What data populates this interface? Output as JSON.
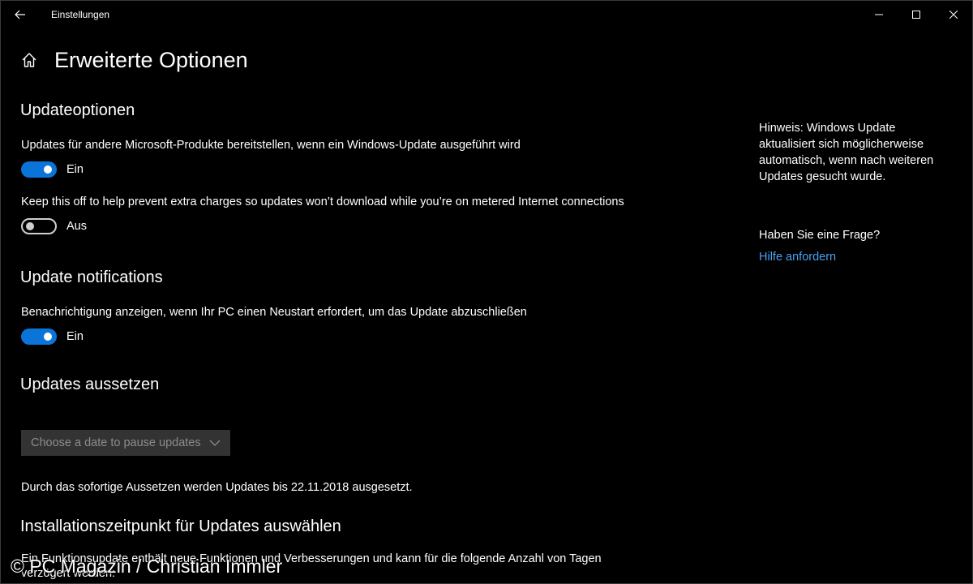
{
  "window": {
    "app_title": "Einstellungen"
  },
  "page": {
    "title": "Erweiterte Optionen"
  },
  "update_options": {
    "heading": "Updateoptionen",
    "other_products": {
      "text": "Updates für andere Microsoft-Produkte bereitstellen, wenn ein Windows-Update ausgeführt wird",
      "state": "Ein"
    },
    "metered": {
      "text": "Keep this off to help prevent extra charges so updates won’t download while you’re on metered Internet connections",
      "state": "Aus"
    }
  },
  "notifications": {
    "heading": "Update notifications",
    "restart_notice": {
      "text": "Benachrichtigung anzeigen, wenn Ihr PC einen Neustart erfordert, um das Update abzuschließen",
      "state": "Ein"
    }
  },
  "pause": {
    "heading": "Updates aussetzen",
    "dropdown_placeholder": "Choose a date to pause updates",
    "info": "Durch das sofortige Aussetzen werden Updates bis 22.11.2018 ausgesetzt."
  },
  "install_time": {
    "heading": "Installationszeitpunkt für Updates auswählen",
    "text": "Ein Funktionsupdate enthält neue Funktionen und Verbesserungen und kann für die folgende Anzahl von Tagen verzögert werden:"
  },
  "side": {
    "hint": "Hinweis: Windows Update aktualisiert sich möglicherweise automatisch, wenn nach weiteren Updates gesucht wurde.",
    "question": "Haben Sie eine Frage?",
    "help_link": "Hilfe anfordern"
  },
  "watermark": "© PC Magazin / Christian Immler",
  "colors": {
    "accent": "#0a74d9",
    "link": "#4aa0f0",
    "background": "#000000"
  }
}
